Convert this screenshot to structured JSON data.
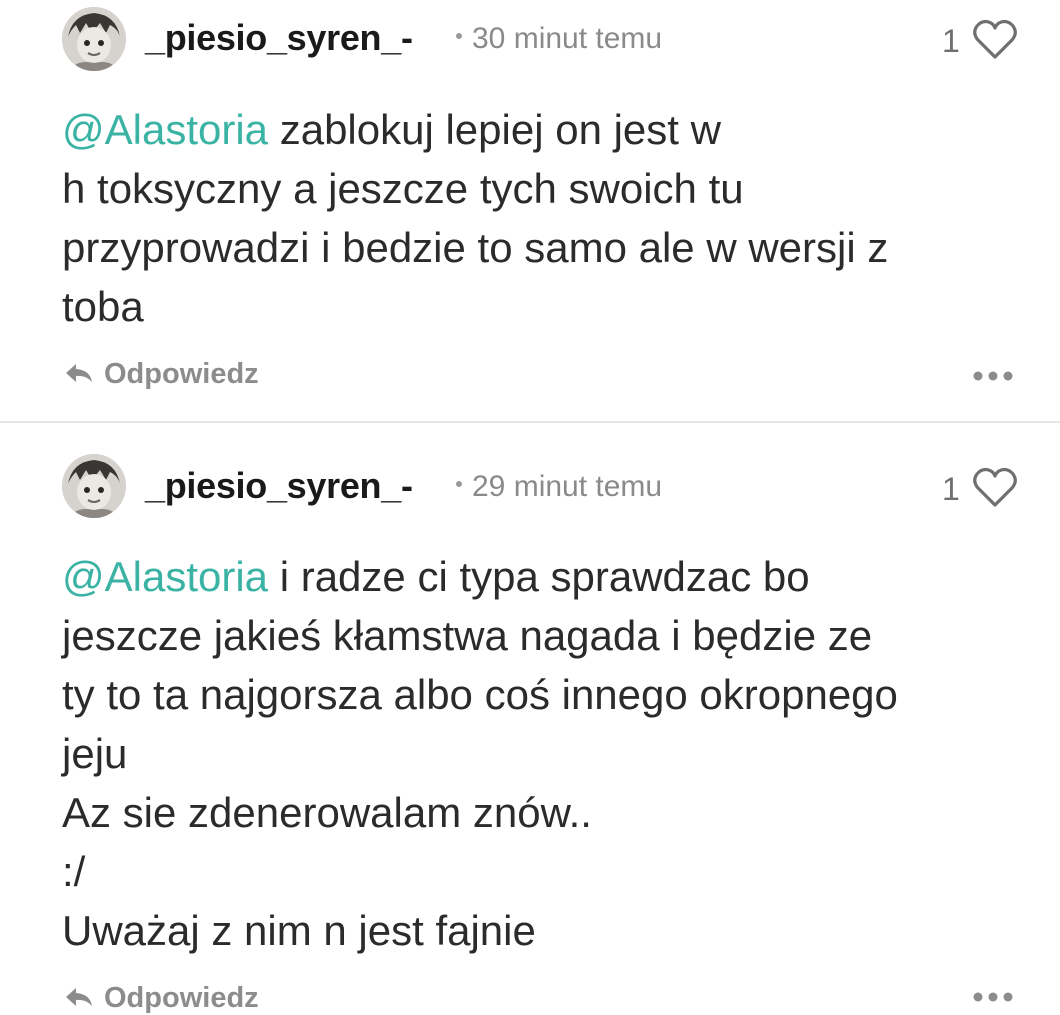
{
  "comments": [
    {
      "username": "_piesio_syren_-",
      "time": "30 minut temu",
      "likes": "1",
      "mention": "@Alastoria",
      "lines": [
        " zablokuj lepiej on jest w",
        "h toksyczny a jeszcze tych swoich tu",
        "przyprowadzi i bedzie to samo ale w wersji z",
        "toba"
      ],
      "reply_label": "Odpowiedz"
    },
    {
      "username": "_piesio_syren_-",
      "time": "29 minut temu",
      "likes": "1",
      "mention": "@Alastoria",
      "lines": [
        " i radze ci typa sprawdzac bo",
        "jeszcze jakieś kłamstwa nagada i będzie ze",
        "ty to ta najgorsza albo coś innego okropnego",
        "jeju",
        "Az sie zdenerowalam znów..",
        ":/",
        "Uważaj z nim n jest fajnie"
      ],
      "reply_label": "Odpowiedz"
    }
  ],
  "icons": {
    "heart": "heart-outline-icon",
    "reply": "reply-arrow-icon",
    "more": "more-horizontal-icon"
  },
  "colors": {
    "mention": "#3bb3a4",
    "meta": "#8a8a8a",
    "text": "#2b2b2b"
  }
}
